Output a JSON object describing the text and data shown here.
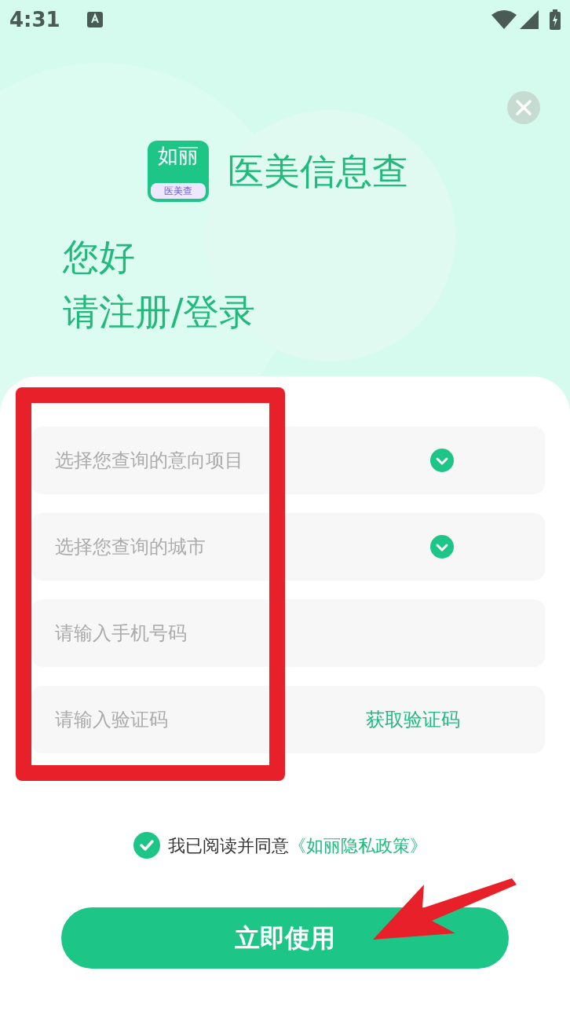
{
  "status_bar": {
    "time": "4:31"
  },
  "header": {
    "app_title": "医美信息查",
    "logo_text": "如丽",
    "logo_caption": "医美查"
  },
  "greeting": [
    "您好",
    "请注册/登录"
  ],
  "fields": [
    {
      "kind": "select",
      "placeholder": "选择您查询的意向项目"
    },
    {
      "kind": "select",
      "placeholder": "选择您查询的城市"
    },
    {
      "kind": "input",
      "placeholder": "请输入手机号码"
    },
    {
      "kind": "code",
      "placeholder": "请输入验证码",
      "action": "获取验证码"
    }
  ],
  "agreement": {
    "checked": true,
    "text": "我已阅读并同意",
    "link": "《如丽隐私政策》"
  },
  "submit_button": "立即使用"
}
